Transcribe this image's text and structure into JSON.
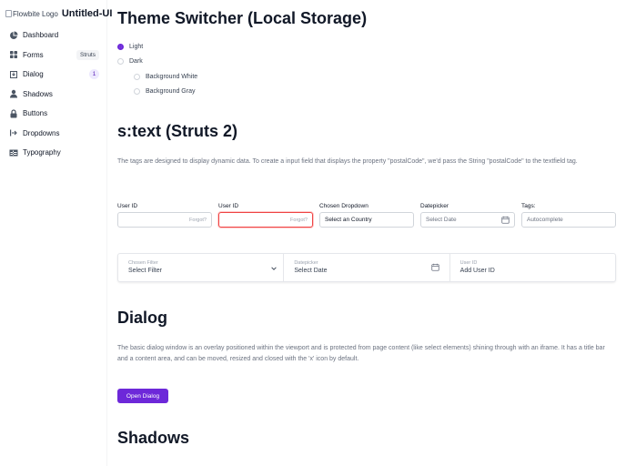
{
  "sidebar": {
    "logo_alt": "Flowbite Logo",
    "brand": "Untitled-UI",
    "items": [
      {
        "label": "Dashboard",
        "icon": "pie-chart-icon"
      },
      {
        "label": "Forms",
        "icon": "grid-icon",
        "badge": "Struts"
      },
      {
        "label": "Dialog",
        "icon": "download-box-icon",
        "badge": "1"
      },
      {
        "label": "Shadows",
        "icon": "user-icon"
      },
      {
        "label": "Buttons",
        "icon": "lock-icon"
      },
      {
        "label": "Dropdowns",
        "icon": "arrow-to-line-icon"
      },
      {
        "label": "Typography",
        "icon": "table-icon"
      }
    ]
  },
  "theme": {
    "title": "Theme Switcher (Local Storage)",
    "options": [
      {
        "label": "Light",
        "checked": true
      },
      {
        "label": "Dark",
        "checked": false
      }
    ],
    "sub_options": [
      {
        "label": "Background White",
        "checked": false
      },
      {
        "label": "Background Gray",
        "checked": false
      }
    ]
  },
  "stext": {
    "title": "s:text (Struts 2)",
    "description": "The tags are designed to display dynamic data. To create a input field that displays the property \"postalCode\", we'd pass the String \"postalCode\" to the textfield tag.",
    "fields": [
      {
        "label": "User ID",
        "value": "",
        "hint": "Forgot?"
      },
      {
        "label": "User ID",
        "value": "",
        "hint": "Forgot?"
      },
      {
        "label": "Chosen Dropdown",
        "value": "Select an Country"
      },
      {
        "label": "Datepicker",
        "placeholder": "Select Date"
      },
      {
        "label": "Tags:",
        "placeholder": "Autocomplete"
      }
    ],
    "filter": [
      {
        "label": "Chosen Filter",
        "value": "Select Filter"
      },
      {
        "label": "Datepicker",
        "value": "Select Date"
      },
      {
        "label": "User ID",
        "value": "Add User ID"
      }
    ]
  },
  "dialog": {
    "title": "Dialog",
    "description": "The basic dialog window is an overlay positioned within the viewport and is protected from page content (like select elements) shining through with an iframe. It has a title bar and a content area, and can be moved, resized and closed with the 'x' icon by default.",
    "button": "Open Dialog"
  },
  "shadows": {
    "title": "Shadows"
  },
  "colors": {
    "accent": "#6d28d9",
    "error": "#ef4444"
  }
}
